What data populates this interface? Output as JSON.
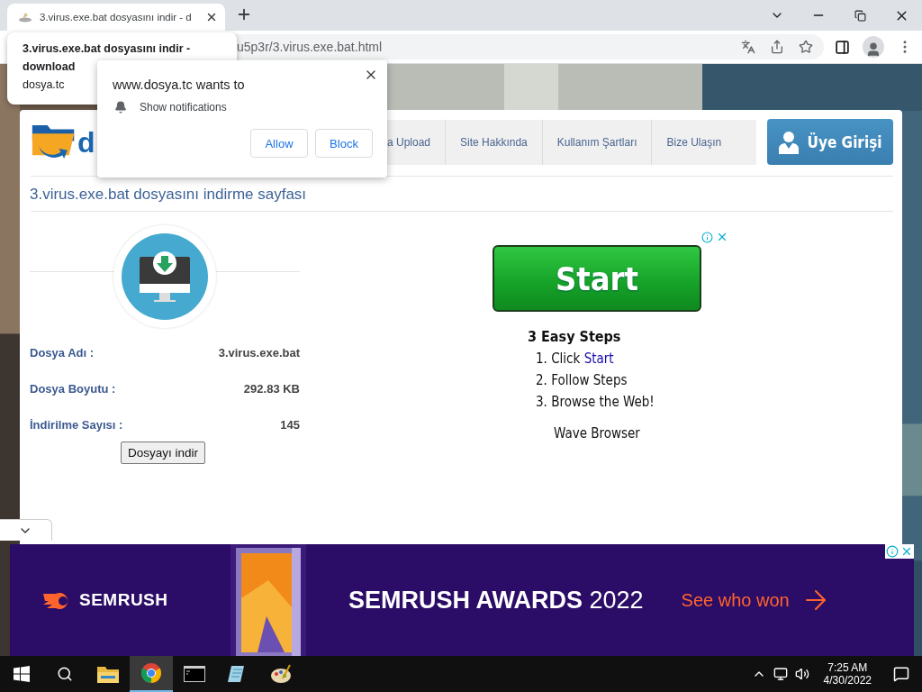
{
  "browser": {
    "tab": {
      "title": "3.virus.exe.bat dosyasını indir - d",
      "selected": true
    },
    "address": "u5p3r/3.virus.exe.bat.html"
  },
  "tab_hover_card": {
    "title": "3.virus.exe.bat dosyasını indir - download",
    "domain": "dosya.tc"
  },
  "permission_prompt": {
    "title": "www.dosya.tc wants to",
    "permission": "Show notifications",
    "buttons": [
      "Allow",
      "Block"
    ]
  },
  "site": {
    "logo": "d",
    "nav": [
      "a Upload",
      "Site Hakkında",
      "Kullanım Şartları",
      "Bize Ulaşın"
    ],
    "login": "Üye Girişi",
    "heading": "3.virus.exe.bat dosyasını indirme sayfası",
    "file_info": [
      {
        "label": "Dosya Adı :",
        "value": "3.virus.exe.bat"
      },
      {
        "label": "Dosya Boyutu :",
        "value": "292.83 KB"
      },
      {
        "label": "İndirilme Sayısı :",
        "value": "145"
      }
    ],
    "download_button": "Dosyayı indir"
  },
  "ad": {
    "button": "Start",
    "heading": "3 Easy Steps",
    "steps": [
      {
        "text": "1. Click",
        "link": "Start"
      },
      {
        "text": "2. Follow Steps"
      },
      {
        "text": "3. Browse the Web!"
      }
    ],
    "brand": "Wave Browser"
  },
  "banner_ad": {
    "logo": "SEMRUSH",
    "headline": "**SEMRUSH AWARDS** 2022",
    "cta": "See who won"
  },
  "taskbar": {
    "time": "7:25 AM",
    "date": "4/30/2022"
  }
}
